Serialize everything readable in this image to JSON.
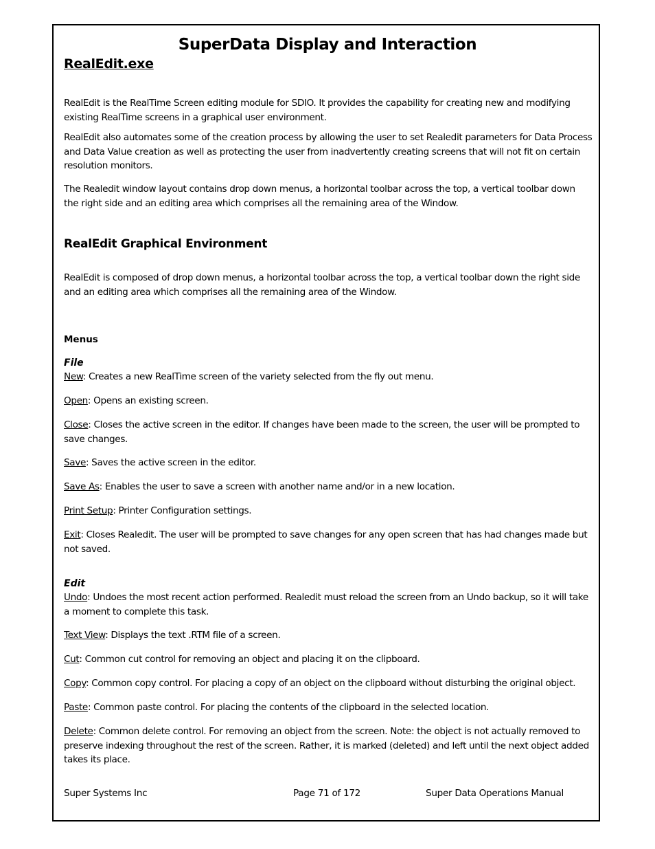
{
  "header": {
    "title": "SuperData Display and Interaction",
    "section_title": "RealEdit.exe"
  },
  "intro": {
    "p1": "RealEdit is the RealTime Screen editing module for SDIO.  It provides the capability for creating new and modifying existing RealTime screens in a graphical user environment.",
    "p2": "RealEdit also automates some of the creation process by allowing the user to set Realedit parameters for Data Process and Data Value creation as well as protecting the user from inadvertently creating screens that will not fit on certain resolution monitors.",
    "p3": "The Realedit window layout contains drop down menus, a horizontal toolbar across the top, a vertical toolbar down the right side and an editing area which comprises all the remaining area of the Window."
  },
  "environment": {
    "heading": "RealEdit Graphical Environment",
    "p1": "RealEdit is composed of drop down menus, a horizontal toolbar across the top, a vertical toolbar down the right side and an editing area which comprises all the remaining area of the Window."
  },
  "menus": {
    "heading": "Menus",
    "file": {
      "heading": "File",
      "items": [
        {
          "term": "New",
          "desc": ": Creates a new RealTime screen of the variety selected from the fly out menu."
        },
        {
          "term": "Open",
          "desc": ": Opens an existing screen."
        },
        {
          "term": "Close",
          "desc": ": Closes the active screen in the editor.  If changes have been made to the screen, the user will be prompted to save changes."
        },
        {
          "term": "Save",
          "desc": ": Saves the active screen in the editor."
        },
        {
          "term": "Save As",
          "desc": ": Enables the user to save a screen with another name and/or in a new location."
        },
        {
          "term": "Print Setup",
          "desc": ": Printer Configuration settings."
        },
        {
          "term": "Exit",
          "desc": ": Closes Realedit.  The user will be prompted to save changes for any open screen that has had changes made but not saved."
        }
      ]
    },
    "edit": {
      "heading": "Edit",
      "items": [
        {
          "term": "Undo",
          "desc": ": Undoes the most recent action performed.  Realedit must reload the screen from an Undo backup, so it will take a moment to complete this task."
        },
        {
          "term": "Text View",
          "desc": ": Displays the text .RTM file of a screen."
        },
        {
          "term": "Cut",
          "desc": ": Common cut control for removing an object and placing it on the clipboard."
        },
        {
          "term": "Copy",
          "desc": ": Common copy control.  For placing a copy of an object on the clipboard without disturbing the original object."
        },
        {
          "term": "Paste",
          "desc": ": Common paste control.  For placing the contents of the clipboard in the selected location."
        },
        {
          "term": "Delete",
          "desc": ": Common delete control.  For removing an object from the screen.  Note:  the object is not actually removed to preserve indexing throughout the rest of the screen.  Rather, it is marked (deleted) and left until the next object added takes its place."
        }
      ]
    }
  },
  "footer": {
    "company": "Super Systems Inc",
    "page": "Page 71 of 172",
    "manual": "Super Data Operations Manual"
  }
}
